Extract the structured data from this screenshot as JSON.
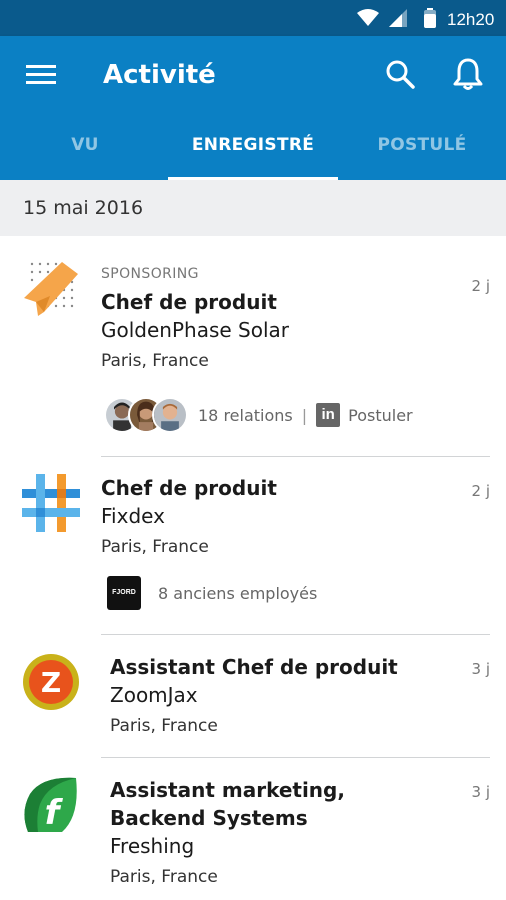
{
  "status_bar": {
    "time": "12h20"
  },
  "app_bar": {
    "title": "Activité"
  },
  "tabs": [
    {
      "label": "VU",
      "active": false
    },
    {
      "label": "ENREGISTRÉ",
      "active": true
    },
    {
      "label": "POSTULÉ",
      "active": false
    }
  ],
  "date_header": "15 mai 2016",
  "jobs": [
    {
      "eyebrow": "SPONSORING",
      "title": "Chef de produit",
      "company": "GoldenPhase Solar",
      "location": "Paris, France",
      "age": "2 j",
      "relations": "18 relations",
      "separator": "|",
      "apply": "Postuler",
      "apply_badge": "in"
    },
    {
      "title": "Chef de produit",
      "company": "Fixdex",
      "location": "Paris, France",
      "age": "2 j",
      "employer_badge": "FJORD",
      "alumni": "8 anciens employés"
    },
    {
      "title": "Assistant Chef de produit",
      "company": "ZoomJax",
      "location": "Paris, France",
      "age": "3 j",
      "logo_letter": "Z"
    },
    {
      "title_line1": "Assistant marketing,",
      "title_line2": "Backend Systems",
      "company": "Freshing",
      "location": "Paris, France",
      "age": "3 j",
      "logo_letter": "f"
    }
  ],
  "colors": {
    "status_bar": "#0a5a8c",
    "app_bar": "#0b80c4",
    "date_header_bg": "#eeeff1"
  }
}
